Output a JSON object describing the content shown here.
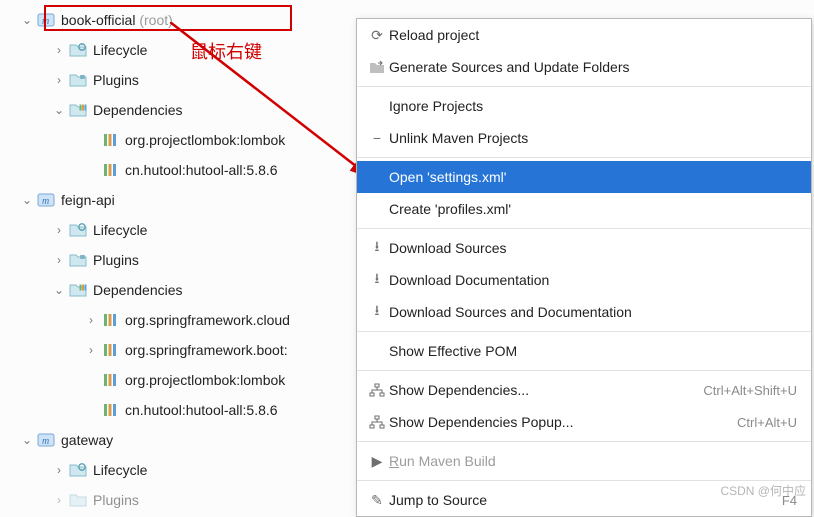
{
  "tree": {
    "p0": {
      "name": "book-official",
      "suffix": "(root)"
    },
    "lifecycle": "Lifecycle",
    "plugins": "Plugins",
    "dependencies": "Dependencies",
    "dep_lombok": "org.projectlombok:lombok",
    "dep_hutool": "cn.hutool:hutool-all:5.8.6",
    "p1": "feign-api",
    "dep_spring_cloud": "org.springframework.cloud",
    "dep_spring_boot": "org.springframework.boot:",
    "p2": "gateway"
  },
  "annotation": "鼠标右键",
  "menu": {
    "reload": "Reload project",
    "generate": "Generate Sources and Update Folders",
    "ignore": "Ignore Projects",
    "unlink": "Unlink Maven Projects",
    "open_settings": "Open 'settings.xml'",
    "create_profiles": "Create 'profiles.xml'",
    "dl_sources": "Download Sources",
    "dl_docs": "Download Documentation",
    "dl_both": "Download Sources and Documentation",
    "effective_pom": "Show Effective POM",
    "show_deps": "Show Dependencies...",
    "show_deps_sc": "Ctrl+Alt+Shift+U",
    "show_deps_popup": "Show Dependencies Popup...",
    "show_deps_popup_sc": "Ctrl+Alt+U",
    "run_build_pre": "R",
    "run_build": "un Maven Build",
    "jump": "Jump to Source",
    "jump_sc": "F4"
  },
  "watermark": "CSDN @何中应"
}
